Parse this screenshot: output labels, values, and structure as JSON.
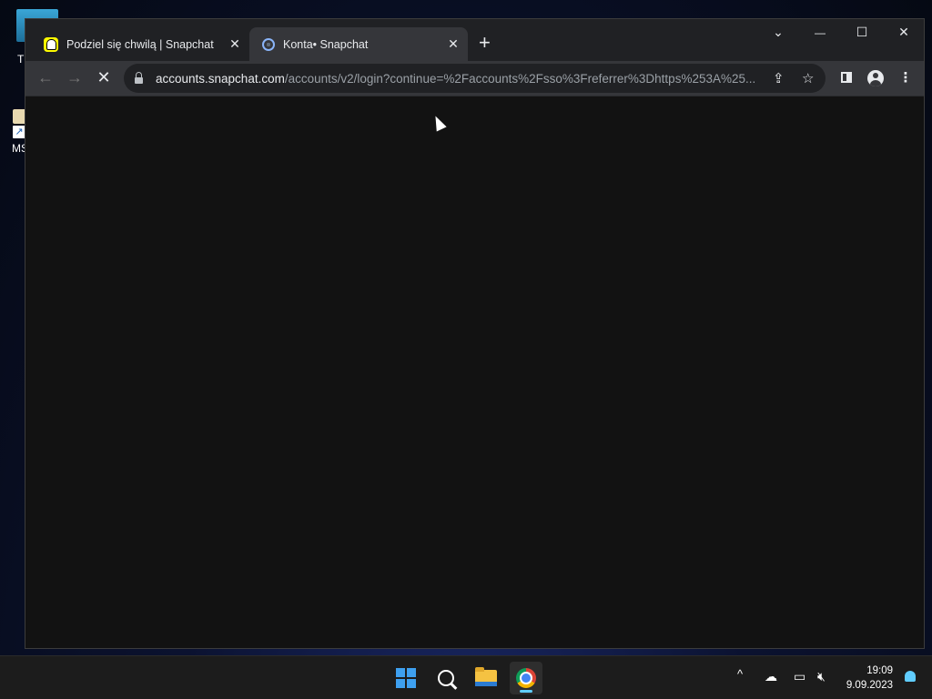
{
  "desktop": {
    "icon1_label": "Tl",
    "icon2_label": "MS"
  },
  "browser": {
    "tabs": [
      {
        "title": "Podziel się chwilą | Snapchat",
        "close": "✕",
        "favicon": "snapchat-ghost"
      },
      {
        "title": "Konta• Snapchat",
        "close": "✕",
        "favicon": "globe-loading"
      }
    ],
    "new_tab": "+",
    "window_controls": {
      "tab_search": "⌄",
      "minimize": "—",
      "maximize": "☐",
      "close": "✕"
    },
    "nav": {
      "back": "←",
      "forward": "→",
      "stop": "✕"
    },
    "url": {
      "host": "accounts.snapchat.com",
      "rest": "/accounts/v2/login?continue=%2Faccounts%2Fsso%3Freferrer%3Dhttps%253A%25..."
    },
    "omnibox_icons": {
      "share": "⇪",
      "bookmark": "☆"
    },
    "toolbar_icons": {
      "menu": "⋮"
    }
  },
  "taskbar": {
    "tray": {
      "chevron": "^"
    },
    "clock": {
      "time": "19:09",
      "date": "9.09.2023"
    }
  },
  "colors": {
    "accent": "#60cdff",
    "snapchat_yellow": "#fffc00",
    "page_bg": "#121212"
  }
}
